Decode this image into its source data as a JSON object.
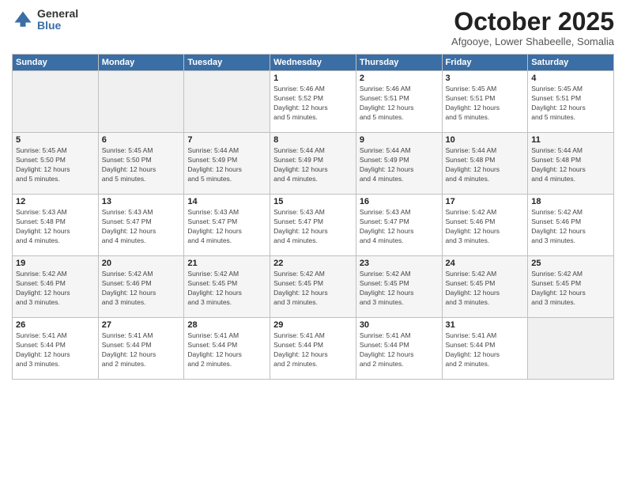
{
  "logo": {
    "general": "General",
    "blue": "Blue"
  },
  "header": {
    "month": "October 2025",
    "location": "Afgooye, Lower Shabeelle, Somalia"
  },
  "weekdays": [
    "Sunday",
    "Monday",
    "Tuesday",
    "Wednesday",
    "Thursday",
    "Friday",
    "Saturday"
  ],
  "weeks": [
    [
      {
        "day": "",
        "info": ""
      },
      {
        "day": "",
        "info": ""
      },
      {
        "day": "",
        "info": ""
      },
      {
        "day": "1",
        "info": "Sunrise: 5:46 AM\nSunset: 5:52 PM\nDaylight: 12 hours\nand 5 minutes."
      },
      {
        "day": "2",
        "info": "Sunrise: 5:46 AM\nSunset: 5:51 PM\nDaylight: 12 hours\nand 5 minutes."
      },
      {
        "day": "3",
        "info": "Sunrise: 5:45 AM\nSunset: 5:51 PM\nDaylight: 12 hours\nand 5 minutes."
      },
      {
        "day": "4",
        "info": "Sunrise: 5:45 AM\nSunset: 5:51 PM\nDaylight: 12 hours\nand 5 minutes."
      }
    ],
    [
      {
        "day": "5",
        "info": "Sunrise: 5:45 AM\nSunset: 5:50 PM\nDaylight: 12 hours\nand 5 minutes."
      },
      {
        "day": "6",
        "info": "Sunrise: 5:45 AM\nSunset: 5:50 PM\nDaylight: 12 hours\nand 5 minutes."
      },
      {
        "day": "7",
        "info": "Sunrise: 5:44 AM\nSunset: 5:49 PM\nDaylight: 12 hours\nand 5 minutes."
      },
      {
        "day": "8",
        "info": "Sunrise: 5:44 AM\nSunset: 5:49 PM\nDaylight: 12 hours\nand 4 minutes."
      },
      {
        "day": "9",
        "info": "Sunrise: 5:44 AM\nSunset: 5:49 PM\nDaylight: 12 hours\nand 4 minutes."
      },
      {
        "day": "10",
        "info": "Sunrise: 5:44 AM\nSunset: 5:48 PM\nDaylight: 12 hours\nand 4 minutes."
      },
      {
        "day": "11",
        "info": "Sunrise: 5:44 AM\nSunset: 5:48 PM\nDaylight: 12 hours\nand 4 minutes."
      }
    ],
    [
      {
        "day": "12",
        "info": "Sunrise: 5:43 AM\nSunset: 5:48 PM\nDaylight: 12 hours\nand 4 minutes."
      },
      {
        "day": "13",
        "info": "Sunrise: 5:43 AM\nSunset: 5:47 PM\nDaylight: 12 hours\nand 4 minutes."
      },
      {
        "day": "14",
        "info": "Sunrise: 5:43 AM\nSunset: 5:47 PM\nDaylight: 12 hours\nand 4 minutes."
      },
      {
        "day": "15",
        "info": "Sunrise: 5:43 AM\nSunset: 5:47 PM\nDaylight: 12 hours\nand 4 minutes."
      },
      {
        "day": "16",
        "info": "Sunrise: 5:43 AM\nSunset: 5:47 PM\nDaylight: 12 hours\nand 4 minutes."
      },
      {
        "day": "17",
        "info": "Sunrise: 5:42 AM\nSunset: 5:46 PM\nDaylight: 12 hours\nand 3 minutes."
      },
      {
        "day": "18",
        "info": "Sunrise: 5:42 AM\nSunset: 5:46 PM\nDaylight: 12 hours\nand 3 minutes."
      }
    ],
    [
      {
        "day": "19",
        "info": "Sunrise: 5:42 AM\nSunset: 5:46 PM\nDaylight: 12 hours\nand 3 minutes."
      },
      {
        "day": "20",
        "info": "Sunrise: 5:42 AM\nSunset: 5:46 PM\nDaylight: 12 hours\nand 3 minutes."
      },
      {
        "day": "21",
        "info": "Sunrise: 5:42 AM\nSunset: 5:45 PM\nDaylight: 12 hours\nand 3 minutes."
      },
      {
        "day": "22",
        "info": "Sunrise: 5:42 AM\nSunset: 5:45 PM\nDaylight: 12 hours\nand 3 minutes."
      },
      {
        "day": "23",
        "info": "Sunrise: 5:42 AM\nSunset: 5:45 PM\nDaylight: 12 hours\nand 3 minutes."
      },
      {
        "day": "24",
        "info": "Sunrise: 5:42 AM\nSunset: 5:45 PM\nDaylight: 12 hours\nand 3 minutes."
      },
      {
        "day": "25",
        "info": "Sunrise: 5:42 AM\nSunset: 5:45 PM\nDaylight: 12 hours\nand 3 minutes."
      }
    ],
    [
      {
        "day": "26",
        "info": "Sunrise: 5:41 AM\nSunset: 5:44 PM\nDaylight: 12 hours\nand 3 minutes."
      },
      {
        "day": "27",
        "info": "Sunrise: 5:41 AM\nSunset: 5:44 PM\nDaylight: 12 hours\nand 2 minutes."
      },
      {
        "day": "28",
        "info": "Sunrise: 5:41 AM\nSunset: 5:44 PM\nDaylight: 12 hours\nand 2 minutes."
      },
      {
        "day": "29",
        "info": "Sunrise: 5:41 AM\nSunset: 5:44 PM\nDaylight: 12 hours\nand 2 minutes."
      },
      {
        "day": "30",
        "info": "Sunrise: 5:41 AM\nSunset: 5:44 PM\nDaylight: 12 hours\nand 2 minutes."
      },
      {
        "day": "31",
        "info": "Sunrise: 5:41 AM\nSunset: 5:44 PM\nDaylight: 12 hours\nand 2 minutes."
      },
      {
        "day": "",
        "info": ""
      }
    ]
  ]
}
